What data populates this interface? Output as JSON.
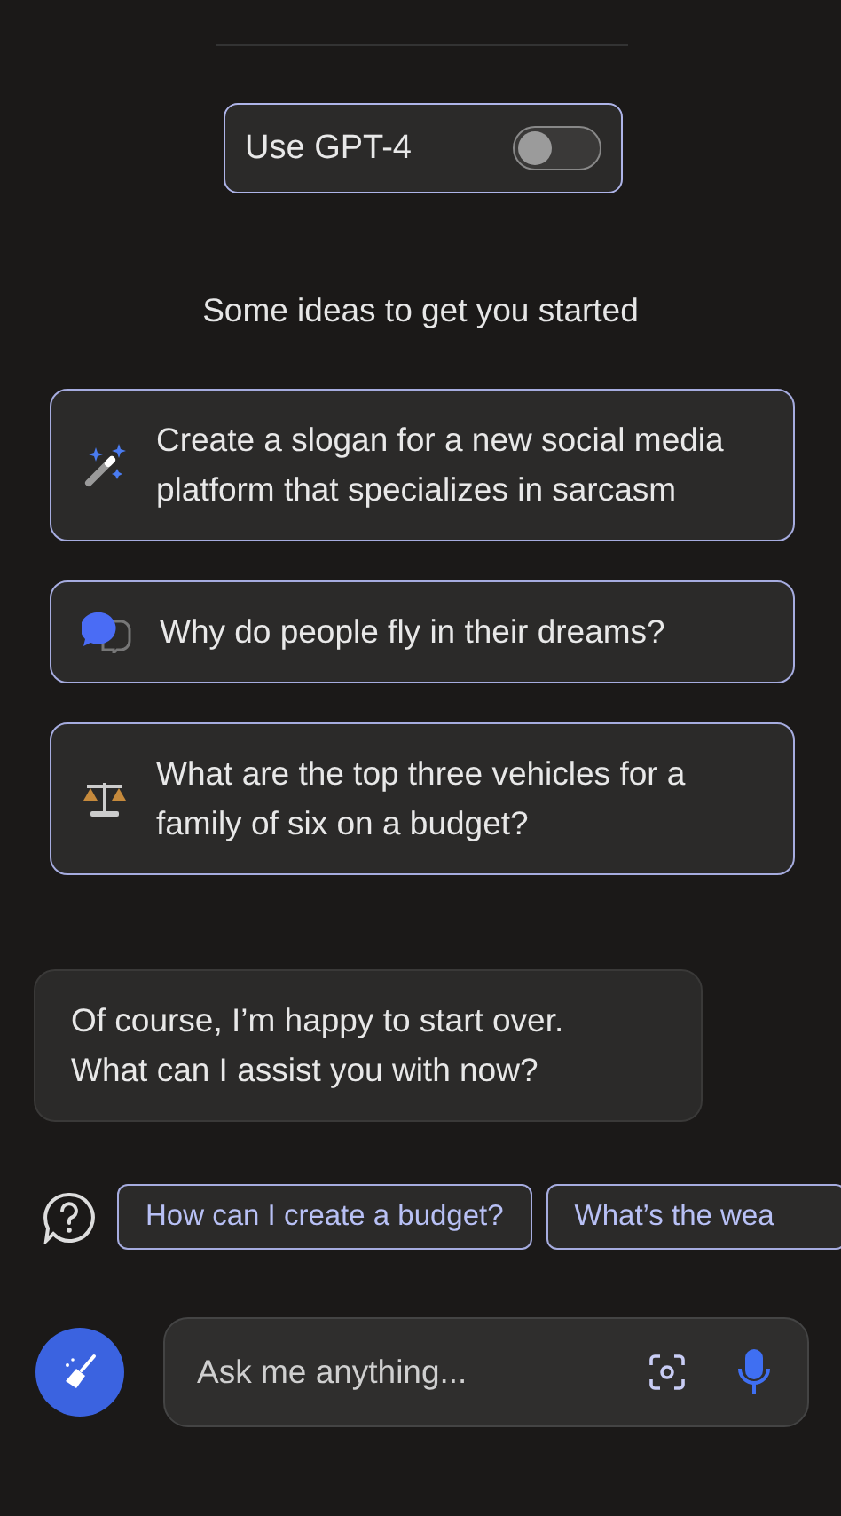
{
  "gpt4_toggle": {
    "label": "Use GPT-4",
    "on": false
  },
  "ideas_heading": "Some ideas to get you started",
  "ideas": [
    {
      "text": "Create a slogan for a new social media platform that specializes in sarcasm"
    },
    {
      "text": "Why do people fly in their dreams?"
    },
    {
      "text": "What are the top three vehicles for a family of six on a budget?"
    }
  ],
  "bot_message": "Of course, I’m happy to start over. What can I assist you with now?",
  "suggestions": [
    "How can I create a budget?",
    "What’s the wea"
  ],
  "input": {
    "placeholder": "Ask me anything..."
  }
}
